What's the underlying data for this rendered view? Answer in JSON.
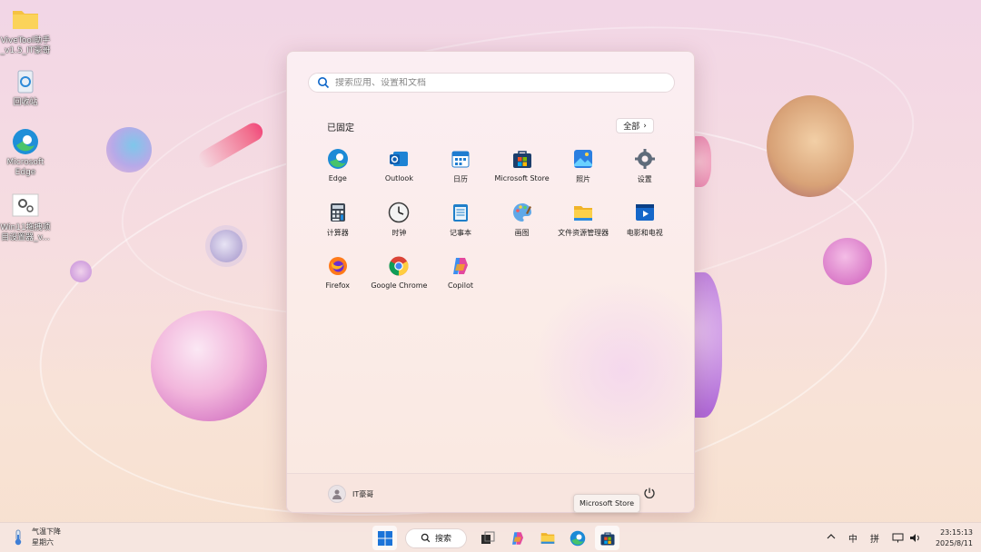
{
  "desktop": {
    "icons": [
      {
        "label": "ViveTool助手_v1.5_IT豪哥",
        "icon": "folder-icon"
      },
      {
        "label": "回收站",
        "icon": "recycle-bin-icon"
      },
      {
        "label": "Microsoft Edge",
        "icon": "edge-icon"
      },
      {
        "label": "Win11拖拽项目设置器_v...",
        "icon": "settings-app-icon"
      }
    ]
  },
  "start_menu": {
    "search_placeholder": "搜索应用、设置和文档",
    "pinned_title": "已固定",
    "all_button": "全部",
    "apps": [
      {
        "name": "Edge",
        "icon": "edge-icon"
      },
      {
        "name": "Outlook",
        "icon": "outlook-icon"
      },
      {
        "name": "日历",
        "icon": "calendar-icon"
      },
      {
        "name": "Microsoft Store",
        "icon": "store-icon"
      },
      {
        "name": "照片",
        "icon": "photos-icon"
      },
      {
        "name": "设置",
        "icon": "gear-icon"
      },
      {
        "name": "计算器",
        "icon": "calculator-icon"
      },
      {
        "name": "时钟",
        "icon": "clock-icon"
      },
      {
        "name": "记事本",
        "icon": "notepad-icon"
      },
      {
        "name": "画图",
        "icon": "paint-icon"
      },
      {
        "name": "文件资源管理器",
        "icon": "folder-icon"
      },
      {
        "name": "电影和电视",
        "icon": "movies-tv-icon"
      },
      {
        "name": "Firefox",
        "icon": "firefox-icon"
      },
      {
        "name": "Google Chrome",
        "icon": "chrome-icon"
      },
      {
        "name": "Copilot",
        "icon": "copilot-icon"
      }
    ],
    "user_name": "IT豪哥",
    "tooltip": "Microsoft Store"
  },
  "taskbar": {
    "weather_line1": "气温下降",
    "weather_line2": "星期六",
    "search_label": "搜索",
    "tray_ime_lang": "中",
    "tray_ime_mode": "拼",
    "time": "23:15:13",
    "date": "2025/8/11"
  },
  "colors": {
    "accent": "#0a64c8",
    "background_top": "#f2d6e6",
    "background_bottom": "#f7e0cf"
  }
}
